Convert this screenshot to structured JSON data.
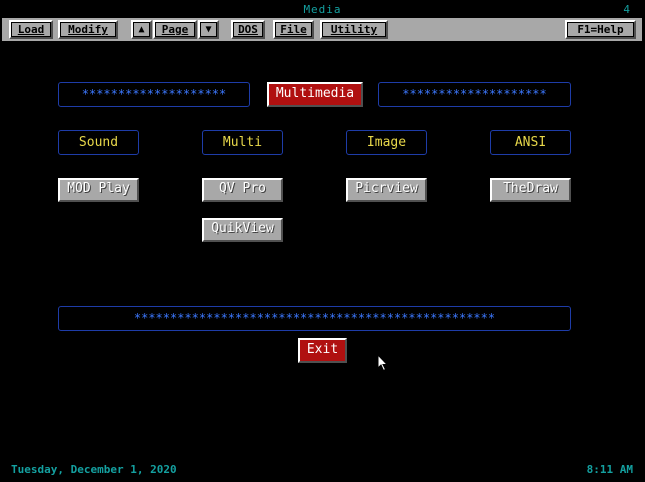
{
  "window": {
    "title": "Media",
    "page_number": "4"
  },
  "menubar": {
    "load": "Load",
    "modify": "Modify",
    "page_up_glyph": "▲",
    "page": "Page",
    "page_down_glyph": "▼",
    "dos": "DOS",
    "file": "File",
    "utility": "Utility",
    "help": "F1=Help"
  },
  "main": {
    "left_stars": "********************",
    "heading": "Multimedia",
    "right_stars": "********************",
    "categories": [
      "Sound",
      "Multi",
      "Image",
      "ANSI"
    ],
    "programs": [
      "MOD Play",
      "QV Pro",
      "Picrview",
      "TheDraw",
      "QuikView"
    ],
    "bottom_stars": "**************************************************",
    "exit": "Exit"
  },
  "status": {
    "date": "Tuesday, December 1, 2020",
    "time": "8:11 AM"
  },
  "colors": {
    "background": "#000000",
    "menubar": "#a8a8a8",
    "teal_text": "#14a0a0",
    "frame_border": "#1e3ca8",
    "star_text": "#3c78ff",
    "category_text": "#e8d84a",
    "red_button": "#b01010",
    "gray_button": "#a8a8a8"
  },
  "icons": {
    "cursor": "mouse-pointer-icon"
  }
}
